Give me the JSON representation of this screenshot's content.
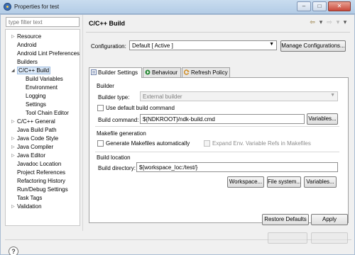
{
  "window": {
    "title": "Properties for test",
    "minimize": "–",
    "maximize": "□",
    "close": "✕"
  },
  "sidebar": {
    "filter_placeholder": "type filter text",
    "items": [
      {
        "label": "Resource",
        "expandable": true
      },
      {
        "label": "Android"
      },
      {
        "label": "Android Lint Preferences"
      },
      {
        "label": "Builders"
      },
      {
        "label": "C/C++ Build",
        "expanded": true,
        "selected": true
      },
      {
        "label": "Build Variables"
      },
      {
        "label": "Environment"
      },
      {
        "label": "Logging"
      },
      {
        "label": "Settings"
      },
      {
        "label": "Tool Chain Editor"
      },
      {
        "label": "C/C++ General",
        "expandable": true
      },
      {
        "label": "Java Build Path"
      },
      {
        "label": "Java Code Style",
        "expandable": true
      },
      {
        "label": "Java Compiler",
        "expandable": true
      },
      {
        "label": "Java Editor",
        "expandable": true
      },
      {
        "label": "Javadoc Location"
      },
      {
        "label": "Project References"
      },
      {
        "label": "Refactoring History"
      },
      {
        "label": "Run/Debug Settings"
      },
      {
        "label": "Task Tags"
      },
      {
        "label": "Validation",
        "expandable": true
      }
    ]
  },
  "page": {
    "title": "C/C++ Build",
    "nav": {
      "back": "⇦",
      "back_menu": "▾",
      "forward": "⇨",
      "forward_menu": "▾",
      "view_menu": "▾"
    },
    "configuration": {
      "label": "Configuration:",
      "value": "Default  [ Active ]",
      "manage_button": "Manage Configurations..."
    },
    "tabs": [
      {
        "label": "Builder Settings",
        "active": true
      },
      {
        "label": "Behaviour"
      },
      {
        "label": "Refresh Policy"
      }
    ],
    "builder": {
      "section_title": "Builder",
      "type_label": "Builder type:",
      "type_value": "External builder",
      "use_default_label": "Use default build command",
      "use_default_checked": false,
      "command_label": "Build command:",
      "command_value": "${NDKROOT}/ndk-build.cmd",
      "variables_button": "Variables..."
    },
    "makefile": {
      "section_title": "Makefile generation",
      "generate_label": "Generate Makefiles automatically",
      "generate_checked": false,
      "expand_env_label": "Expand Env. Variable Refs in Makefiles",
      "expand_env_checked": false
    },
    "location": {
      "section_title": "Build location",
      "dir_label": "Build directory:",
      "dir_value": "${workspace_loc:/test/}",
      "workspace_button": "Workspace...",
      "filesystem_button": "File system...",
      "variables_button": "Variables..."
    },
    "restore_button": "Restore Defaults",
    "apply_button": "Apply"
  },
  "footer": {
    "help_icon": "?"
  },
  "colors": {
    "titlebar": "#b3cce6",
    "selection": "#d9e7f7",
    "tab_behaviour_icon": "#2e8b3a",
    "tab_refresh_icon": "#d08a1c",
    "tab_builder_icon": "#6b7fa8"
  }
}
